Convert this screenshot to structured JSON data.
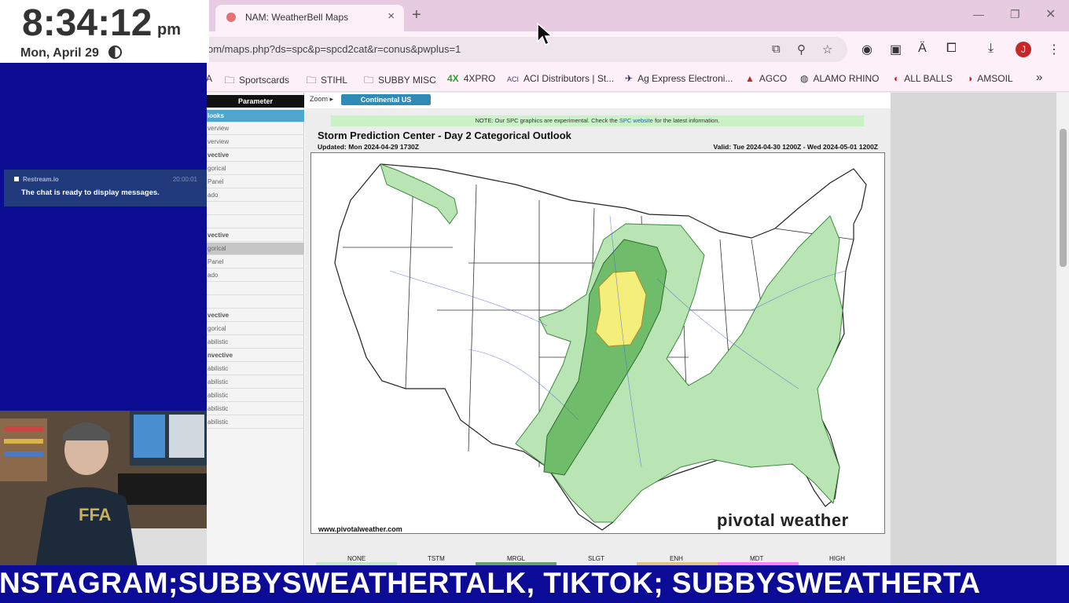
{
  "overlay": {
    "clock_time": "8:34:12",
    "clock_ampm": "pm",
    "clock_date": "Mon, April 29",
    "chat_source": "Restream.io",
    "chat_time": "20:00:01",
    "chat_message": "The chat is ready to display messages.",
    "ticker_text": "NSTAGRAM;SUBBYSWEATHERTALK,  TIKTOK; SUBBYSWEATHERTA"
  },
  "browser": {
    "tab_title": "NAM: WeatherBell Maps",
    "tab_close": "×",
    "new_tab": "+",
    "url": "om/maps.php?ds=spc&p=spcd2cat&r=conus&pwplus=1",
    "profile_initial": "J",
    "bookmarks": [
      {
        "icon": "folder-icon",
        "label": "Sportscards"
      },
      {
        "icon": "folder-icon",
        "label": "STIHL"
      },
      {
        "icon": "folder-icon",
        "label": "SUBBY MISC"
      },
      {
        "icon": "4x-icon",
        "label": "4XPRO"
      },
      {
        "icon": "aci-icon",
        "label": "ACI Distributors | St..."
      },
      {
        "icon": "ag-express-icon",
        "label": "Ag Express Electroni..."
      },
      {
        "icon": "agco-icon",
        "label": "AGCO"
      },
      {
        "icon": "globe-icon",
        "label": "ALAMO RHINO"
      },
      {
        "icon": "all-balls-icon",
        "label": "ALL BALLS"
      },
      {
        "icon": "amsoil-icon",
        "label": "AMSOIL"
      }
    ],
    "bookmarks_more": "»"
  },
  "page": {
    "parameter_header": "Parameter",
    "param_rows": [
      {
        "label": "looks",
        "style": "blue"
      },
      {
        "label": "verview",
        "style": ""
      },
      {
        "label": "verview",
        "style": ""
      },
      {
        "label": "vective",
        "style": "b"
      },
      {
        "label": "gorical",
        "style": ""
      },
      {
        "label": "Panel",
        "style": ""
      },
      {
        "label": "ado",
        "style": ""
      },
      {
        "label": "",
        "style": ""
      },
      {
        "label": "",
        "style": ""
      },
      {
        "label": "vective",
        "style": "b"
      },
      {
        "label": "gorical",
        "style": "sel"
      },
      {
        "label": "Panel",
        "style": ""
      },
      {
        "label": "ado",
        "style": ""
      },
      {
        "label": "",
        "style": ""
      },
      {
        "label": "",
        "style": ""
      },
      {
        "label": "vective",
        "style": "b"
      },
      {
        "label": "gorical",
        "style": ""
      },
      {
        "label": "abilistic",
        "style": ""
      },
      {
        "label": "nvective",
        "style": "b"
      },
      {
        "label": "abilistic",
        "style": ""
      },
      {
        "label": "abilistic",
        "style": ""
      },
      {
        "label": "abilistic",
        "style": ""
      },
      {
        "label": "abilistic",
        "style": ""
      },
      {
        "label": "abilistic",
        "style": ""
      }
    ],
    "zoom_label": "Zoom ▸",
    "zoom_value": "Continental US",
    "note_prefix": "NOTE: Our SPC graphics are experimental. Check the ",
    "note_link": "SPC website",
    "note_suffix": " for the latest information.",
    "map_title": "Storm Prediction Center - Day 2 Categorical Outlook",
    "updated": "Updated: Mon 2024-04-29 1730Z",
    "valid": "Valid: Tue 2024-04-30 1200Z - Wed 2024-05-01 1200Z",
    "website": "www.pivotalweather.com",
    "logo": "pivotal weather",
    "legend": [
      {
        "label": "NONE",
        "color": "#ffffff"
      },
      {
        "label": "TSTM",
        "color": "#c1e9c1"
      },
      {
        "label": "MRGL",
        "color": "#66a366"
      },
      {
        "label": "SLGT",
        "color": "#f6f67f"
      },
      {
        "label": "ENH",
        "color": "#e6c27f"
      },
      {
        "label": "MDT",
        "color": "#e67f7f"
      },
      {
        "label": "HIGH",
        "color": "#ff7fff"
      }
    ]
  },
  "colors": {
    "tstm": "#b9e4b3",
    "mrgl": "#6fbd6b",
    "slgt": "#f3ef7a",
    "ticker_bg": "#0b0b98",
    "blue_panel": "#0c0c92"
  }
}
